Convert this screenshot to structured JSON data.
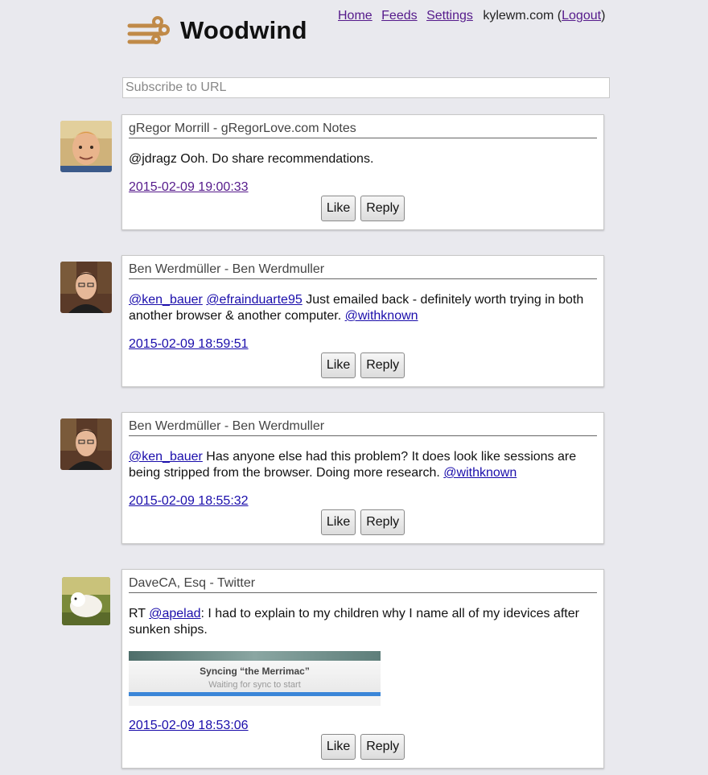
{
  "header": {
    "app_name": "Woodwind",
    "nav": {
      "home": "Home",
      "feeds": "Feeds",
      "settings": "Settings",
      "user": "kylewm.com",
      "logout": "Logout"
    }
  },
  "subscribe": {
    "placeholder": "Subscribe to URL"
  },
  "entries": [
    {
      "author": "gRegor Morrill - gRegorLove.com Notes",
      "text": "@jdragz Ooh. Do share recommendations.",
      "timestamp": "2015-02-09 19:00:33",
      "like_label": "Like",
      "reply_label": "Reply"
    },
    {
      "author": "Ben Werdmüller - Ben Werdmuller",
      "mention1": "@ken_bauer",
      "mention2": "@efrainduarte95",
      "text": " Just emailed back - definitely worth trying in both another browser & another computer. ",
      "mention3": "@withknown",
      "timestamp": "2015-02-09 18:59:51",
      "like_label": "Like",
      "reply_label": "Reply"
    },
    {
      "author": "Ben Werdmüller - Ben Werdmuller",
      "mention1": "@ken_bauer",
      "text": " Has anyone else had this problem? It does look like sessions are being stripped from the browser. Doing more research. ",
      "mention2": "@withknown",
      "timestamp": "2015-02-09 18:55:32",
      "like_label": "Like",
      "reply_label": "Reply"
    },
    {
      "author": "DaveCA, Esq - Twitter",
      "prefix": "RT ",
      "mention1": "@apelad",
      "text": ": I had to explain to my children why I name all of my idevices after sunken ships.",
      "image_title": "Syncing “the Merrimac”",
      "image_subtitle": "Waiting for sync to start",
      "timestamp": "2015-02-09 18:53:06",
      "like_label": "Like",
      "reply_label": "Reply"
    }
  ]
}
